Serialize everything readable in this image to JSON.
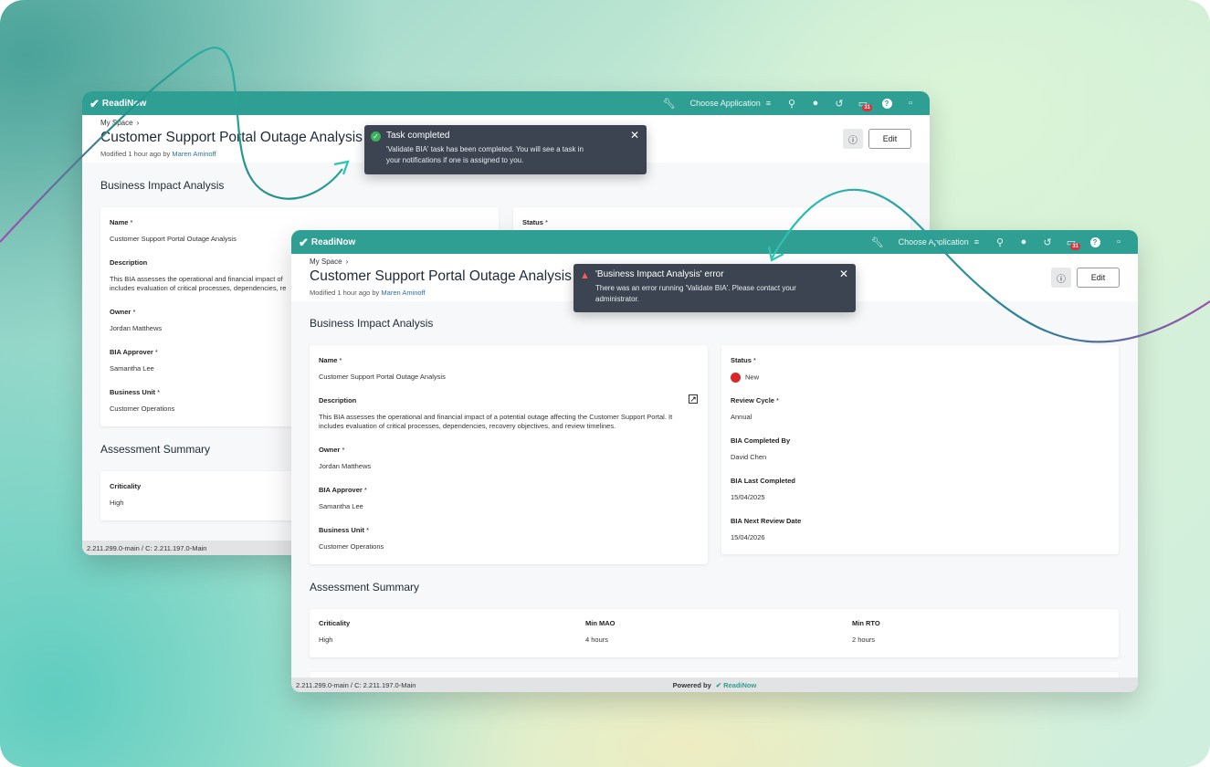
{
  "colors": {
    "brand": "#2f9f93",
    "status_new": "#d9262b",
    "toast_bg": "#3b4450",
    "success": "#3ab15b",
    "error": "#ff5a5a",
    "link": "#2a6fb0",
    "curve_teal": "#2fc3b3",
    "curve_purple": "#a24fb0"
  },
  "appbar": {
    "logo_text": "ReadiNow",
    "choose_application": "Choose Application",
    "icons": [
      "wrench-icon",
      "menu-icon",
      "search-icon",
      "user-icon",
      "history-icon",
      "notifications-icon",
      "help-icon",
      "window-icon"
    ],
    "notification_count": "31"
  },
  "back_window": {
    "breadcrumb": "My Space",
    "title": "Customer Support Portal Outage Analysis",
    "modified_prefix": "Modified 1 hour ago by",
    "modified_user": "Maren Aminoff",
    "section_bia": "Business Impact Analysis",
    "fields": {
      "name_label": "Name",
      "name_value": "Customer Support Portal Outage Analysis",
      "description_label": "Description",
      "description_value": "This BIA assesses the operational and financial impact of",
      "description_value_2": "includes evaluation of critical processes, dependencies, re",
      "owner_label": "Owner",
      "owner_value": "Jordan Matthews",
      "approver_label": "BIA Approver",
      "approver_value": "Samantha Lee",
      "unit_label": "Business Unit",
      "unit_value": "Customer Operations",
      "status_label": "Status"
    },
    "section_assessment": "Assessment Summary",
    "criticality_label": "Criticality",
    "criticality_value": "High",
    "footer_version": "2.211.299.0-main / C: 2.211.197.0-Main",
    "toast": {
      "title": "Task completed",
      "body_line1": "'Validate BIA' task has been completed. You will see a task in",
      "body_line2": "your notifications if one is assigned to you."
    }
  },
  "front_window": {
    "breadcrumb": "My Space",
    "title": "Customer Support Portal Outage Analysis",
    "modified_prefix": "Modified 1 hour ago by",
    "modified_user": "Maren Aminoff",
    "edit_label": "Edit",
    "section_bia": "Business Impact Analysis",
    "left_fields": {
      "name_label": "Name",
      "name_value": "Customer Support Portal Outage Analysis",
      "description_label": "Description",
      "description_line1": "This BIA assesses the operational and financial impact of a potential outage affecting the Customer Support Portal. It",
      "description_line2": "includes evaluation of critical processes, dependencies, recovery objectives, and review timelines.",
      "owner_label": "Owner",
      "owner_value": "Jordan Matthews",
      "approver_label": "BIA Approver",
      "approver_value": "Samantha Lee",
      "unit_label": "Business Unit",
      "unit_value": "Customer Operations"
    },
    "right_fields": {
      "status_label": "Status",
      "status_value": "New",
      "review_cycle_label": "Review Cycle",
      "review_cycle_value": "Annual",
      "completed_by_label": "BIA Completed By",
      "completed_by_value": "David Chen",
      "last_completed_label": "BIA Last Completed",
      "last_completed_value": "15/04/2025",
      "next_review_label": "BIA Next Review Date",
      "next_review_value": "15/04/2026"
    },
    "section_assessment": "Assessment Summary",
    "summary": [
      {
        "label": "Criticality",
        "value": "High"
      },
      {
        "label": "Min MAO",
        "value": "4 hours"
      },
      {
        "label": "Min RTO",
        "value": "2 hours"
      }
    ],
    "footer_version": "2.211.299.0-main / C: 2.211.197.0-Main",
    "powered_by": "Powered by",
    "powered_logo": "ReadiNow",
    "toast": {
      "title": "'Business Impact Analysis' error",
      "body_line1": "There was an error running 'Validate BIA'. Please contact your",
      "body_line2": "administrator."
    }
  }
}
